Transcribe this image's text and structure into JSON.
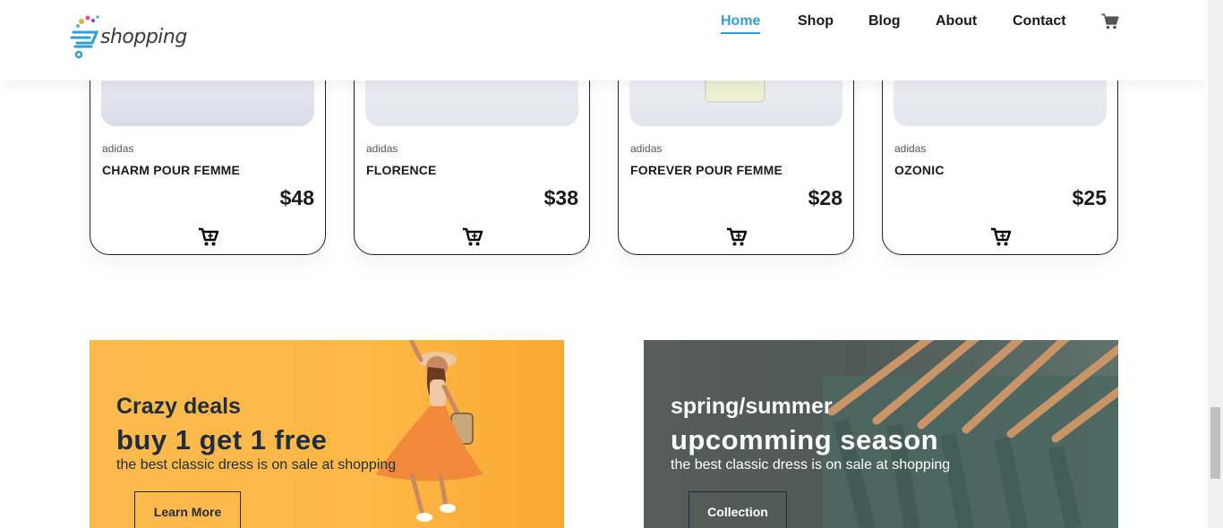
{
  "header": {
    "logo_text": "shopping",
    "nav": [
      {
        "label": "Home",
        "active": true
      },
      {
        "label": "Shop"
      },
      {
        "label": "Blog"
      },
      {
        "label": "About"
      },
      {
        "label": "Contact"
      }
    ],
    "cart_icon": "cart-icon"
  },
  "products": [
    {
      "brand": "adidas",
      "name": "CHARM POUR FEMME",
      "price": "$48"
    },
    {
      "brand": "adidas",
      "name": "FLORENCE",
      "price": "$38"
    },
    {
      "brand": "adidas",
      "name": "FOREVER POUR FEMME",
      "price": "$28"
    },
    {
      "brand": "adidas",
      "name": "OZONIC",
      "price": "$25"
    }
  ],
  "banners": [
    {
      "subtitle": "Crazy deals",
      "title": "buy 1 get 1 free",
      "description": "the best classic dress is on sale at shopping",
      "button": "Learn More"
    },
    {
      "subtitle": "spring/summer",
      "title": "upcomming season",
      "description": "the best classic dress is on sale at shopping",
      "button": "Collection"
    }
  ],
  "colors": {
    "accent": "#2f9fd8",
    "text": "#1a1a1a",
    "banner_dark": "#1f2d3d"
  }
}
